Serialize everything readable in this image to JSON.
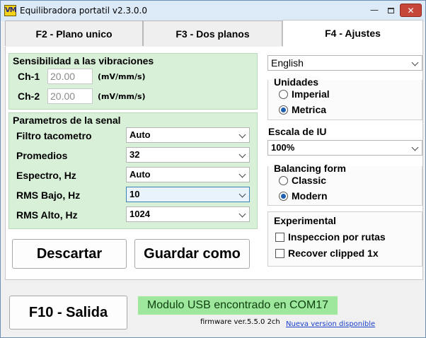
{
  "window": {
    "title": "Equilibradora portatil v2.3.0.0",
    "icon_text": "VM",
    "controls": {
      "minimize": "—",
      "close": "✕"
    }
  },
  "tabs": [
    {
      "label": "F2 - Plano unico"
    },
    {
      "label": "F3 - Dos planos"
    },
    {
      "label": "F4 - Ajustes",
      "active": true
    }
  ],
  "sensitivity": {
    "title": "Sensibilidad a las vibraciones",
    "channels": [
      {
        "label": "Ch-1",
        "value": "20.00",
        "unit": "(mV/mm/s)"
      },
      {
        "label": "Ch-2",
        "value": "20.00",
        "unit": "(mV/mm/s)"
      }
    ]
  },
  "signal": {
    "title": "Parametros de la senal",
    "rows": [
      {
        "label": "Filtro tacometro",
        "value": "Auto"
      },
      {
        "label": "Promedios",
        "value": "32"
      },
      {
        "label": "Espectro, Hz",
        "value": "Auto"
      },
      {
        "label": "RMS Bajo, Hz",
        "value": "10",
        "focused": true
      },
      {
        "label": "RMS Alto, Hz",
        "value": "1024"
      }
    ]
  },
  "buttons": {
    "discard": "Descartar",
    "save_as": "Guardar como",
    "exit": "F10 - Salida"
  },
  "language": {
    "value": "English"
  },
  "units": {
    "title": "Unidades",
    "options": [
      "Imperial",
      "Metrica"
    ],
    "selected": "Metrica"
  },
  "ui_scale": {
    "label": "Escala de IU",
    "value": "100%"
  },
  "balancing_form": {
    "title": "Balancing form",
    "options": [
      "Classic",
      "Modern"
    ],
    "selected": "Modern"
  },
  "experimental": {
    "title": "Experimental",
    "options": [
      {
        "label": "Inspeccion por rutas",
        "checked": false
      },
      {
        "label": "Recover clipped 1x",
        "checked": false
      }
    ]
  },
  "status": {
    "usb_message": "Modulo USB encontrado en COM17",
    "firmware": "firmware ver.5.5.0 2ch",
    "new_version_link": "Nueva version disponible"
  },
  "colors": {
    "group_bg": "#d8efd8",
    "usb_bg": "#9ee89e",
    "link": "#1a3fcc",
    "close_btn": "#c7463a"
  }
}
